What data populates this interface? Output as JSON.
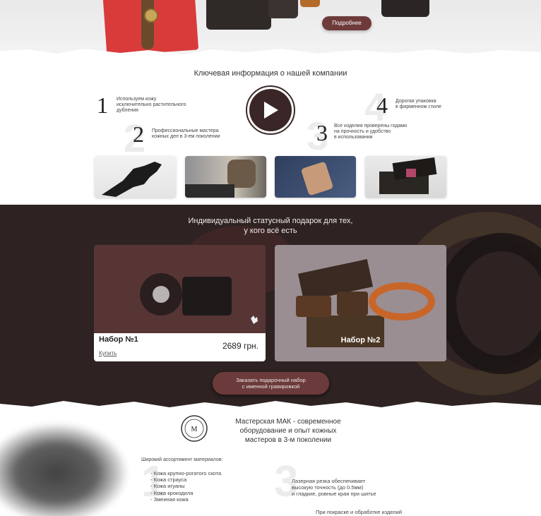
{
  "hero": {
    "more_label": "Подробнее"
  },
  "key_info": {
    "title": "Ключевая информация о нашей компании",
    "features": [
      {
        "num": "1",
        "text": "Используем кожу\nисключительно растительного\nдубления"
      },
      {
        "num": "2",
        "text": "Профессиональные мастера\nкожных дел в 3-ем поколении"
      },
      {
        "num": "3",
        "text": "Все изделия проверены годами\nна прочность и удобство\nв использовании"
      },
      {
        "num": "4",
        "text": "Дорогая упаковка\nв фирменном стиле"
      }
    ]
  },
  "gift": {
    "title_line1": "Индивидуальный статусный подарок для тех,",
    "title_line2": "у кого всё есть",
    "card1": {
      "name": "Набор №1",
      "price": "2689 грн.",
      "buy_label": "Купить"
    },
    "card2": {
      "name": "Набор №2"
    },
    "order_line1": "Заказать подарочный набор",
    "order_line2": "с именной гравировкой"
  },
  "mak": {
    "title_line1": "Мастерская МАК - современное",
    "title_line2": "оборудование и опыт кожных",
    "title_line3": "мастеров в 3-м поколении",
    "materials_heading": "Широкий ассортимент материалов:",
    "materials": [
      "- Кожа крупно-рогатого скота",
      "- Кожа страуса",
      "- Кожа игуаны",
      "- Кожа крокодила",
      "- Змеиная кожа"
    ],
    "laser_line1": "Лазерная резка обеспечивает",
    "laser_line2": "высокую  точность (до 0.5мм)",
    "laser_line3": "и гладкие, ровные края при шитье",
    "paint_text": "При покраске и обработке изделий",
    "ghost_1": "1",
    "ghost_3": "3"
  },
  "colors": {
    "accent": "#6b3b3b",
    "dark_bg": "#2e2222",
    "hero_cloth": "#d93b3b"
  }
}
